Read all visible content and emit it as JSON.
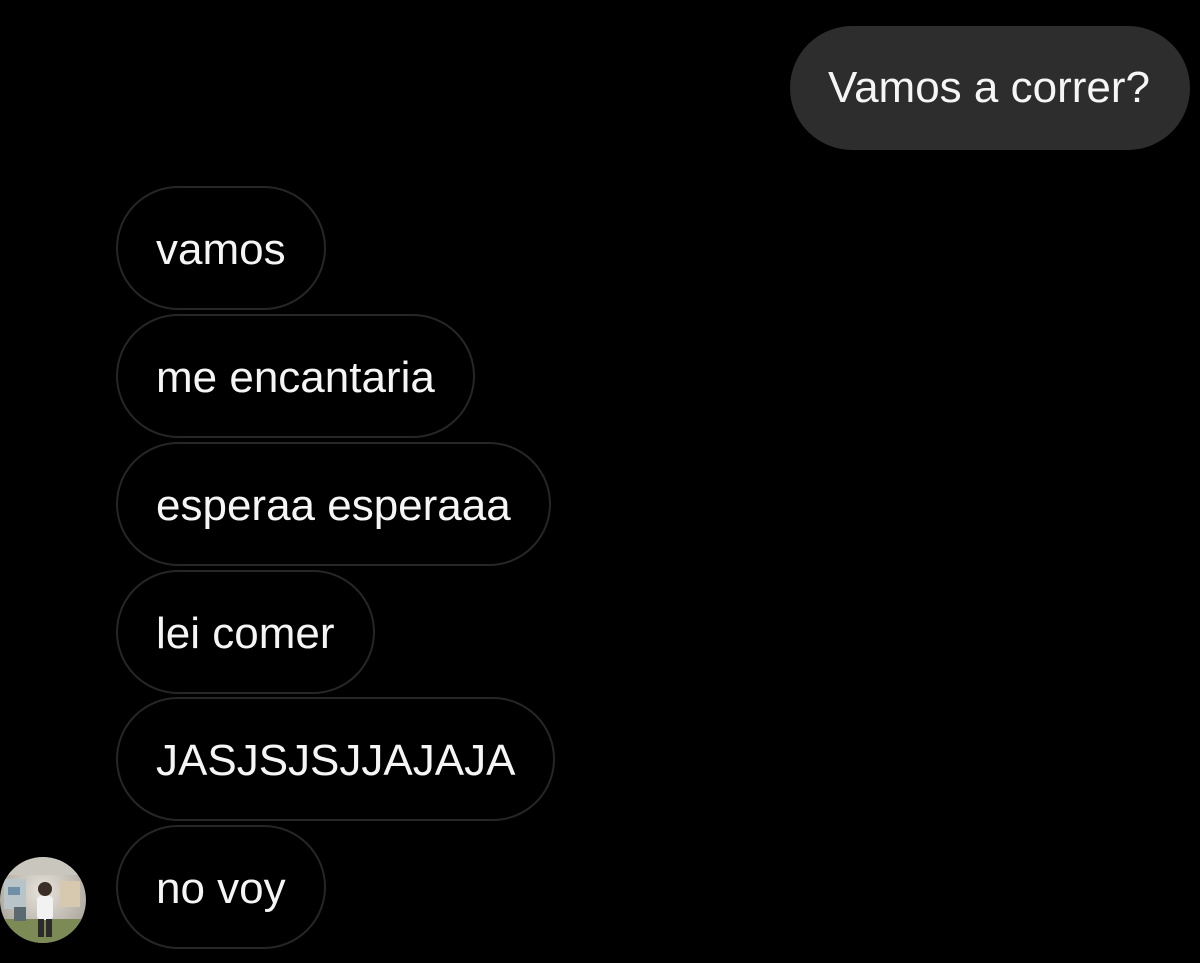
{
  "conversation": {
    "sent_messages": [
      {
        "text": "Vamos a correr?"
      }
    ],
    "received_messages": [
      {
        "text": "vamos"
      },
      {
        "text": "me encantaria"
      },
      {
        "text": "esperaa esperaaa"
      },
      {
        "text": "lei comer"
      },
      {
        "text": "JASJSJSJJAJAJA"
      },
      {
        "text": "no voy"
      }
    ],
    "avatar_icon": "user-avatar-photo"
  },
  "colors": {
    "background": "#000000",
    "sent_bubble": "#2d2d2d",
    "received_bubble_border": "#262626",
    "text": "#f5f5f5"
  }
}
